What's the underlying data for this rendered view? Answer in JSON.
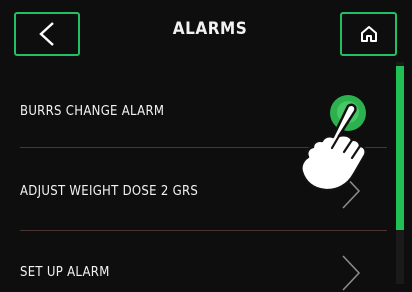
{
  "header": {
    "title": "ALARMS",
    "back_icon": "chevron-left-icon",
    "home_icon": "home-icon"
  },
  "items": [
    {
      "label": "BURRS CHANGE ALARM",
      "control": "toggle",
      "state": "on"
    },
    {
      "label": "ADJUST WEIGHT DOSE 2 GRS",
      "control": "chevron"
    },
    {
      "label": "SET UP ALARM",
      "control": "chevron"
    }
  ],
  "colors": {
    "accent": "#21c064",
    "background": "#0e0e0e",
    "divider": "#4a3434"
  },
  "overlay": {
    "icon": "pointing-hand-icon"
  }
}
